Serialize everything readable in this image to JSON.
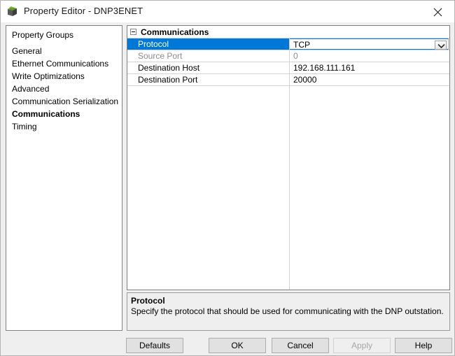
{
  "window": {
    "title": "Property Editor - DNP3ENET",
    "icon": "device-cube-icon",
    "close_label": "✕"
  },
  "sidebar": {
    "header": "Property Groups",
    "items": [
      {
        "label": "General",
        "selected": false
      },
      {
        "label": "Ethernet Communications",
        "selected": false
      },
      {
        "label": "Write Optimizations",
        "selected": false
      },
      {
        "label": "Advanced",
        "selected": false
      },
      {
        "label": "Communication Serialization",
        "selected": false
      },
      {
        "label": "Communications",
        "selected": true
      },
      {
        "label": "Timing",
        "selected": false
      }
    ]
  },
  "grid": {
    "group_title": "Communications",
    "expander_state": "expanded",
    "rows": [
      {
        "name": "Protocol",
        "value": "TCP",
        "selected": true,
        "disabled": false,
        "editor": "dropdown"
      },
      {
        "name": "Source Port",
        "value": "0",
        "selected": false,
        "disabled": true,
        "editor": "text"
      },
      {
        "name": "Destination Host",
        "value": "192.168.111.161",
        "selected": false,
        "disabled": false,
        "editor": "text"
      },
      {
        "name": "Destination Port",
        "value": "20000",
        "selected": false,
        "disabled": false,
        "editor": "text"
      }
    ]
  },
  "description": {
    "title": "Protocol",
    "text": "Specify the protocol that should be used for communicating with the DNP outstation."
  },
  "footer": {
    "buttons": [
      {
        "label": "Defaults",
        "disabled": false
      },
      {
        "label": "OK",
        "disabled": false
      },
      {
        "label": "Cancel",
        "disabled": false
      },
      {
        "label": "Apply",
        "disabled": true
      },
      {
        "label": "Help",
        "disabled": false
      }
    ]
  },
  "colors": {
    "selection_blue": "#0078d7",
    "window_bg": "#efefef",
    "panel_bg": "#ffffff",
    "disabled_text": "#8c8c8c"
  }
}
